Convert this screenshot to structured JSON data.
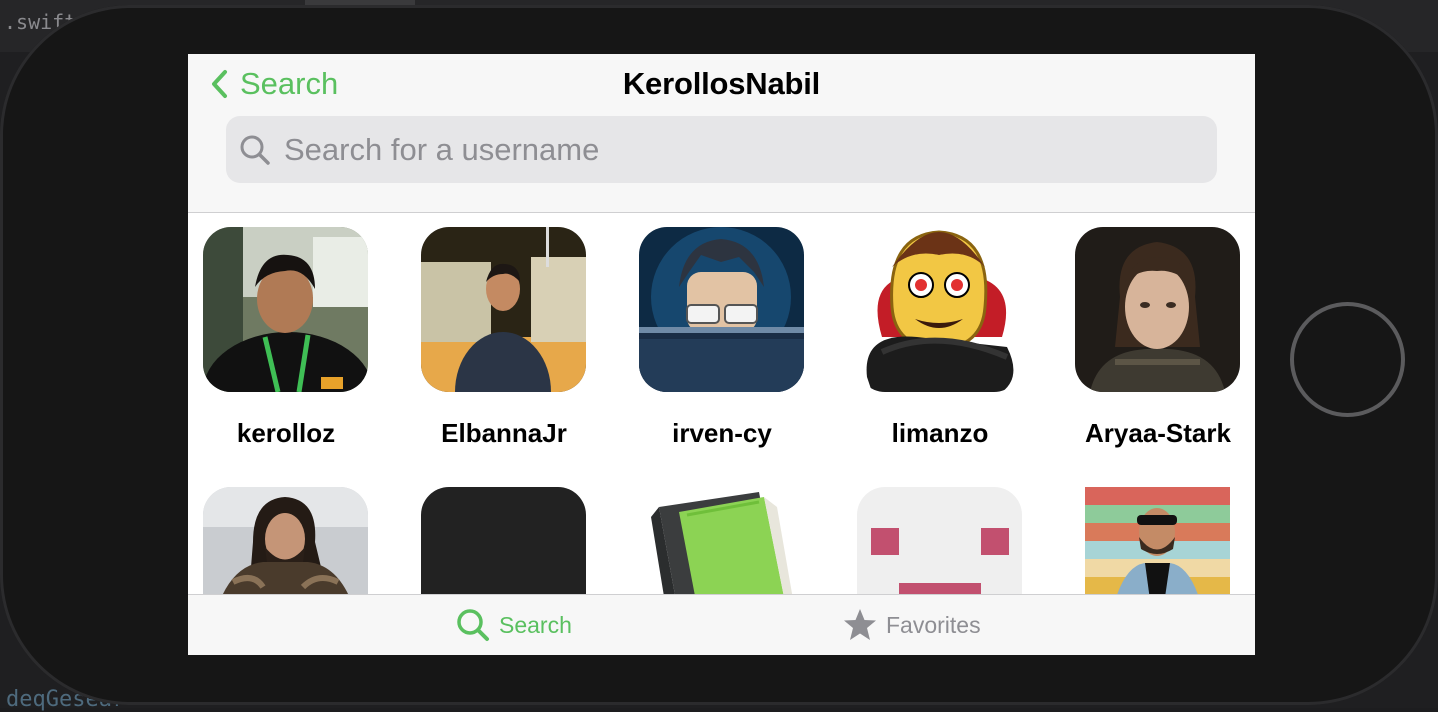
{
  "ide": {
    "file_fragment": ".swift",
    "code_fragment": "deqGesear"
  },
  "nav": {
    "back_label": "Search",
    "title": "KerollosNabil"
  },
  "search": {
    "placeholder": "Search for a username",
    "value": ""
  },
  "users": [
    {
      "username": "kerolloz"
    },
    {
      "username": "ElbannaJr"
    },
    {
      "username": "irven-cy"
    },
    {
      "username": "limanzo"
    },
    {
      "username": "Aryaa-Stark"
    },
    {
      "username": ""
    },
    {
      "username": ""
    },
    {
      "username": ""
    },
    {
      "username": ""
    },
    {
      "username": ""
    }
  ],
  "tabs": {
    "search_label": "Search",
    "favorites_label": "Favorites"
  },
  "colors": {
    "accent": "#5ac05f",
    "inactive": "#8e8e93",
    "bar_background": "#f7f7f7"
  }
}
